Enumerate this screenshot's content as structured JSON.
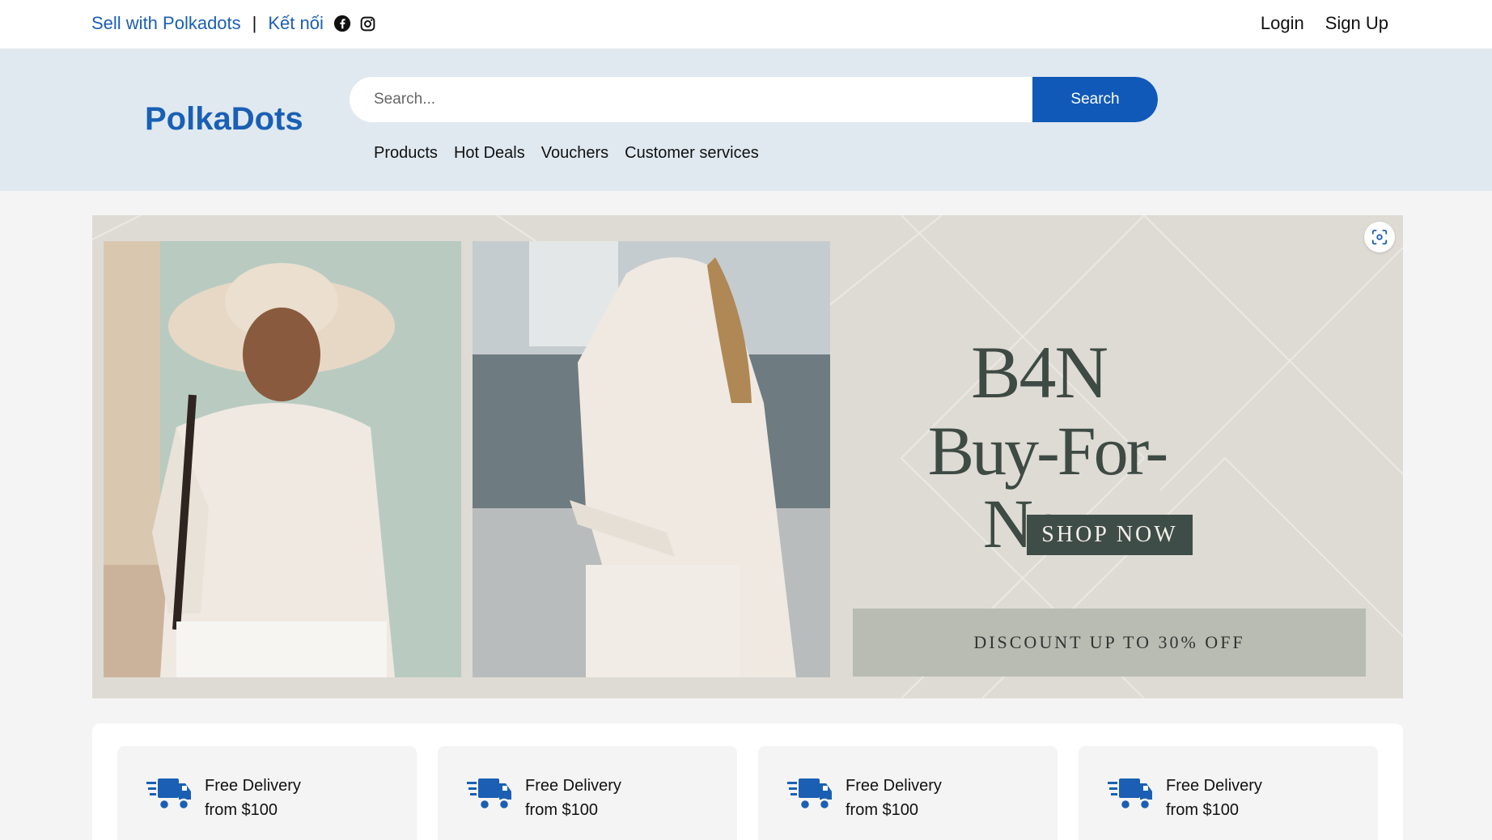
{
  "topbar": {
    "sell_label": "Sell with Polkadots",
    "separator": "|",
    "connect_label": "Kết nối",
    "login_label": "Login",
    "signup_label": "Sign Up"
  },
  "header": {
    "logo": "PolkaDots",
    "search_placeholder": "Search...",
    "search_button": "Search",
    "nav": [
      "Products",
      "Hot Deals",
      "Vouchers",
      "Customer services"
    ]
  },
  "banner": {
    "brand": "B4N",
    "tagline": "Buy-For-Now",
    "cta": "SHOP NOW",
    "discount": "DISCOUNT UP TO 30% OFF"
  },
  "features": [
    {
      "line1": "Free Delivery",
      "line2": "from $100",
      "icon": "delivery-truck-icon"
    },
    {
      "line1": "Free Delivery",
      "line2": "from $100",
      "icon": "delivery-truck-icon"
    },
    {
      "line1": "Free Delivery",
      "line2": "from $100",
      "icon": "delivery-truck-icon"
    },
    {
      "line1": "Free Delivery",
      "line2": "from $100",
      "icon": "delivery-truck-icon"
    }
  ],
  "colors": {
    "brand_blue": "#1a5fb4",
    "button_blue": "#1159b9",
    "header_bg": "#e0e9f0",
    "cta_bg": "#3f4d49"
  }
}
